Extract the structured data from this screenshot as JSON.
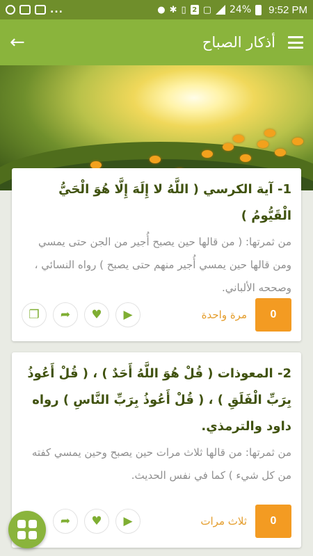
{
  "status_bar": {
    "time": "9:52 PM",
    "battery": "24%",
    "sim_badge": "2",
    "more_dots": "...",
    "icons": [
      "whatsapp-icon",
      "image-icon",
      "gallery-icon",
      "location-icon",
      "bluetooth-icon",
      "vibrate-icon",
      "sim-icon",
      "wifi-off-icon",
      "signal-icon",
      "battery-icon"
    ]
  },
  "app_bar": {
    "title": "أذكار الصباح",
    "back_icon": "arrow-left-icon",
    "menu_icon": "hamburger-menu-icon",
    "background": "#8ab43c"
  },
  "cards": [
    {
      "title": "1- آية الكرسي ( اللَّهُ لا إِلَهَ إِلَّا هُوَ الْحَيُّ الْقَيُّومُ )",
      "body": "من ثمرتها:  ( من قالها حين يصبح أُجير من الجن حتى يمسي ومن قالها حين يمسي أُجير منهم حتى يصبح )  رواه النسائي ، وصححه الألباني.",
      "count": "0",
      "repeat": "مرة واحدة"
    },
    {
      "title": "2- المعوذات ( قُلْ هُوَ اللَّهُ أَحَدٌ ) ، ( قُلْ أَعُوذُ بِرَبِّ الْفَلَقِ ) ، ( قُلْ أَعُوذُ بِرَبِّ النَّاسِ ) رواه داود والترمذي.",
      "body": "من ثمرتها:  من قالها ثلاث مرات حين يصبح وحين يمسي كفته من كل شيء )  كما في نفس الحديث.",
      "count": "0",
      "repeat": "ثلاث مرات"
    }
  ],
  "actions": {
    "play": "▶",
    "favorite": "♥",
    "share": "➦",
    "copy": "❐"
  },
  "fab": {
    "icon": "grid-menu-icon"
  },
  "colors": {
    "primary": "#8ab43c",
    "status_bar": "#6f8e2b",
    "accent": "#f39b22",
    "title_text": "#40520f",
    "body_text": "#8f8f8f",
    "repeat_text": "#e49d2c"
  }
}
